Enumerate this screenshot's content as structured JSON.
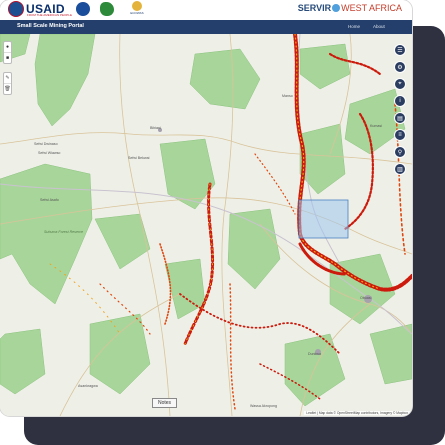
{
  "header": {
    "usaid_label": "USAID",
    "usaid_tagline": "FROM THE AMERICAN PEOPLE",
    "partner_logo_label": "ECOWAS",
    "servir_label": "SERVIR",
    "servir_region": "WEST AFRICA"
  },
  "navbar": {
    "title": "Small Scale Mining Portal",
    "links": [
      "Home",
      "About"
    ]
  },
  "map": {
    "left_controls": [
      "●",
      "■"
    ],
    "left_controls_2": [
      "✎",
      "🗑"
    ],
    "right_tools": [
      "layers-icon",
      "gear-icon",
      "map-pin-icon",
      "info-icon",
      "chart-icon",
      "list-icon",
      "filter-icon",
      "legend-icon"
    ],
    "right_tool_glyphs": [
      "☰",
      "⚙",
      "⌖",
      "i",
      "▤",
      "≡",
      "⚲",
      "▥"
    ],
    "notes_label": "Notes",
    "attribution": "Leaflet | Map data © OpenStreetMap contributors, Imagery © Mapbox",
    "place_labels": {
      "sefwi_dwinaso": "Sefwi Dwinaso",
      "sefwi_wiawso": "Sefwi Wiawso",
      "sefwi_bekwai": "Sefwi Bekwai",
      "sefwi_asafo": "Sefwi Asafo",
      "sui_forest": "Suhuma Forest Reserve",
      "bibiani": "Bibiani",
      "obuasi": "Obuasi",
      "dunkwa": "Dunkwa",
      "wassa_akropong": "Wassa Akropong",
      "asankragwa": "Asankragwa",
      "kumasi": "Kumasi",
      "manso": "Manso"
    },
    "colors": {
      "forest": "#a8d69a",
      "mining_dark": "#cc1a0c",
      "mining_light": "#f2a21a",
      "selection": "#9ec6ee"
    }
  }
}
